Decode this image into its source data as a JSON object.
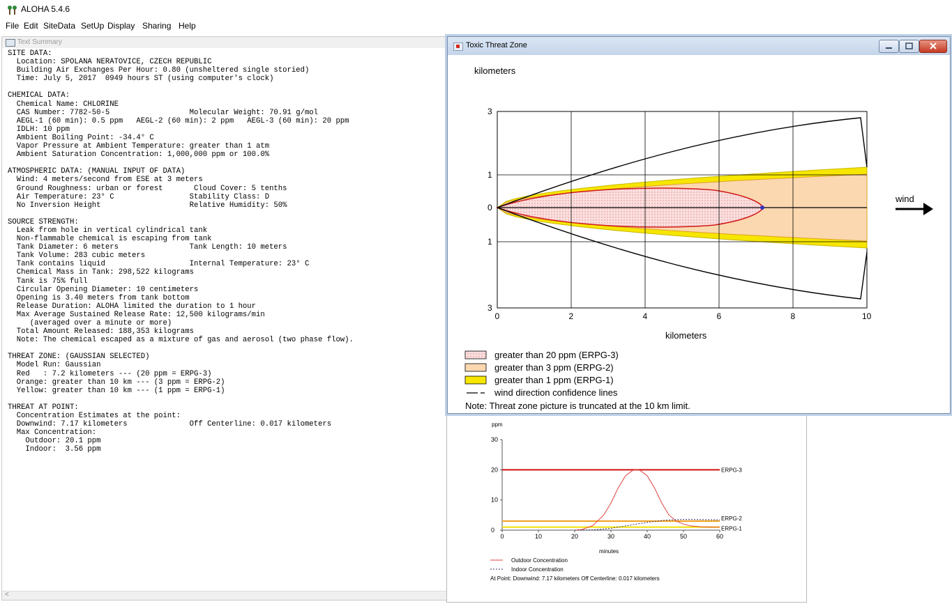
{
  "app": {
    "title": "ALOHA 5.4.6",
    "menu": [
      "File",
      "Edit",
      "SiteData",
      "SetUp",
      "Display",
      "Sharing",
      "Help"
    ]
  },
  "text_summary": {
    "title": "Text Summary",
    "lines": [
      "SITE DATA:",
      "  Location: SPOLANA NERATOVICE, CZECH REPUBLIC",
      "  Building Air Exchanges Per Hour: 0.80 (unsheltered single storied)",
      "  Time: July 5, 2017  0949 hours ST (using computer's clock)",
      "",
      "CHEMICAL DATA:",
      "  Chemical Name: CHLORINE",
      "  CAS Number: 7782-50-5                  Molecular Weight: 70.91 g/mol",
      "  AEGL-1 (60 min): 0.5 ppm   AEGL-2 (60 min): 2 ppm   AEGL-3 (60 min): 20 ppm",
      "  IDLH: 10 ppm",
      "  Ambient Boiling Point: -34.4° C",
      "  Vapor Pressure at Ambient Temperature: greater than 1 atm",
      "  Ambient Saturation Concentration: 1,000,000 ppm or 100.0%",
      "",
      "ATMOSPHERIC DATA: (MANUAL INPUT OF DATA)",
      "  Wind: 4 meters/second from ESE at 3 meters",
      "  Ground Roughness: urban or forest       Cloud Cover: 5 tenths",
      "  Air Temperature: 23° C                 Stability Class: D",
      "  No Inversion Height                    Relative Humidity: 50%",
      "",
      "SOURCE STRENGTH:",
      "  Leak from hole in vertical cylindrical tank",
      "  Non-flammable chemical is escaping from tank",
      "  Tank Diameter: 6 meters                Tank Length: 10 meters",
      "  Tank Volume: 283 cubic meters",
      "  Tank contains liquid                   Internal Temperature: 23° C",
      "  Chemical Mass in Tank: 298,522 kilograms",
      "  Tank is 75% full",
      "  Circular Opening Diameter: 10 centimeters",
      "  Opening is 3.40 meters from tank bottom",
      "  Release Duration: ALOHA limited the duration to 1 hour",
      "  Max Average Sustained Release Rate: 12,500 kilograms/min",
      "     (averaged over a minute or more)",
      "  Total Amount Released: 188,353 kilograms",
      "  Note: The chemical escaped as a mixture of gas and aerosol (two phase flow).",
      "",
      "THREAT ZONE: (GAUSSIAN SELECTED)",
      "  Model Run: Gaussian",
      "  Red   : 7.2 kilometers --- (20 ppm = ERPG-3)",
      "  Orange: greater than 10 km --- (3 ppm = ERPG-2)",
      "  Yellow: greater than 10 km --- (1 ppm = ERPG-1)",
      "",
      "THREAT AT POINT:",
      "  Concentration Estimates at the point:",
      "  Downwind: 7.17 kilometers              Off Centerline: 0.017 kilometers",
      "  Max Concentration:",
      "    Outdoor: 20.1 ppm",
      "    Indoor:  3.56 ppm"
    ]
  },
  "threat_zone": {
    "title": "Toxic Threat Zone",
    "y_unit": "kilometers",
    "x_label": "kilometers",
    "wind_label": "wind",
    "legend": [
      {
        "label": "greater than 20 ppm (ERPG-3)",
        "color": "#f7c6c6"
      },
      {
        "label": "greater than 3 ppm (ERPG-2)",
        "color": "#fbd8b0"
      },
      {
        "label": "greater than 1 ppm (ERPG-1)",
        "color": "#f6e600"
      },
      {
        "label": "wind direction confidence lines",
        "color": "#000000"
      }
    ],
    "note": "Note: Threat zone picture is truncated at the 10 km limit.",
    "chart_data": {
      "type": "area",
      "x_ticks": [
        "0",
        "2",
        "4",
        "6",
        "8",
        "10"
      ],
      "y_ticks": [
        "3",
        "1",
        "0",
        "1",
        "3"
      ],
      "xlim": [
        0,
        10
      ],
      "red_zone_km": 7.2,
      "point_km": 7.17
    }
  },
  "concentration_graph": {
    "y_unit": "ppm",
    "x_label": "minutes",
    "legend": [
      "Outdoor Concentration",
      "Indoor Concentration"
    ],
    "footer": "At Point:  Downwind: 7.17 kilometers  Off Centerline: 0.017 kilometers",
    "chart_data": {
      "type": "line",
      "x_ticks": [
        "0",
        "10",
        "20",
        "30",
        "40",
        "50",
        "60"
      ],
      "y_ticks": [
        "0",
        "10",
        "20",
        "30"
      ],
      "xlim": [
        0,
        60
      ],
      "ylim": [
        0,
        30
      ],
      "thresholds": [
        {
          "name": "ERPG-3",
          "value": 20,
          "color": "#d01010"
        },
        {
          "name": "ERPG-2",
          "value": 3,
          "color": "#f0a020"
        },
        {
          "name": "ERPG-1",
          "value": 1,
          "color": "#f0e000"
        }
      ],
      "series": [
        {
          "name": "Outdoor Concentration",
          "x": [
            20,
            22,
            25,
            28,
            30,
            32,
            34,
            36,
            37,
            38,
            40,
            42,
            44,
            46,
            48,
            50,
            52,
            55,
            58,
            60
          ],
          "values": [
            0,
            0.2,
            1.5,
            5,
            9,
            14,
            18,
            19.8,
            20.1,
            19.8,
            18,
            14,
            9,
            5,
            3,
            2,
            1.4,
            1.1,
            1.0,
            1.0
          ]
        },
        {
          "name": "Indoor Concentration",
          "x": [
            20,
            25,
            30,
            35,
            40,
            45,
            50,
            55,
            60
          ],
          "values": [
            0,
            0.1,
            0.6,
            1.6,
            2.6,
            3.3,
            3.56,
            3.5,
            3.4
          ]
        }
      ]
    }
  }
}
